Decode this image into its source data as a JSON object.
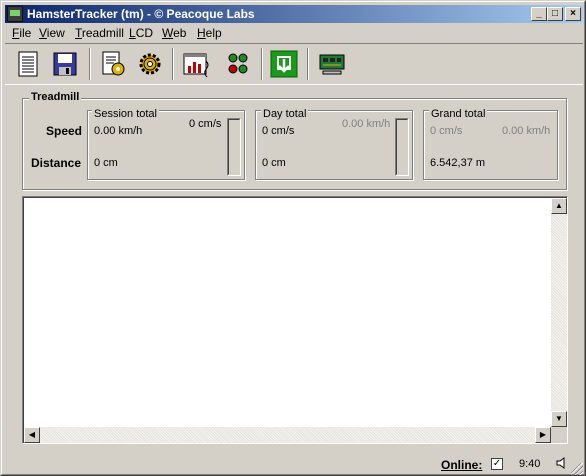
{
  "window": {
    "title": "HamsterTracker (tm) - © Peacoque Labs",
    "controls": {
      "minimize": "_",
      "maximize": "□",
      "close": "×"
    }
  },
  "menu": [
    {
      "pre": "",
      "key": "F",
      "post": "ile"
    },
    {
      "pre": "",
      "key": "V",
      "post": "iew"
    },
    {
      "pre": "",
      "key": "T",
      "post": "readmill"
    },
    {
      "pre": "",
      "key": "L",
      "post": "CD"
    },
    {
      "pre": "",
      "key": "W",
      "post": "eb"
    },
    {
      "pre": "",
      "key": "H",
      "post": "elp"
    }
  ],
  "toolbar": {
    "icons": [
      "report-icon",
      "save-icon",
      "settings-document-icon",
      "gear-icon",
      "chart-window-icon",
      "dots-icon",
      "download-icon",
      "circuit-board-icon"
    ]
  },
  "treadmill": {
    "label": "Treadmill",
    "rows": {
      "speed": "Speed",
      "distance": "Distance"
    },
    "session": {
      "label": "Session total",
      "speed_cms": "0 cm/s",
      "speed_kmh": "0.00 km/h",
      "distance": "0 cm"
    },
    "day": {
      "label": "Day total",
      "speed_kmh": "0.00 km/h",
      "speed_cms": "0 cm/s",
      "distance": "0 cm"
    },
    "grand": {
      "label": "Grand total",
      "speed_cms": "0 cm/s",
      "speed_kmh": "0.00 km/h",
      "distance": "6.542,37 m"
    }
  },
  "status": {
    "online_label": "Online:",
    "online_checked": "✓",
    "time": "9:40"
  },
  "colors": {
    "title_start": "#0a246a",
    "title_end": "#a6caf0",
    "face": "#d4d0c8"
  }
}
